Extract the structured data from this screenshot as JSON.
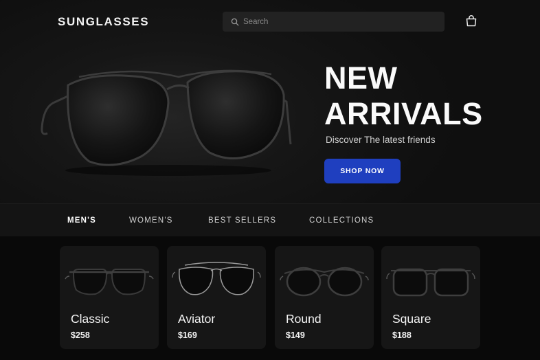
{
  "header": {
    "brand": "SUNGLASSES",
    "search_placeholder": "Search"
  },
  "hero": {
    "title_line1": "NEW",
    "title_line2": "ARRIVALS",
    "subtitle": "Discover The latest friends",
    "cta": "SHOP NOW",
    "cta_color": "#1f3fbf"
  },
  "categories": [
    {
      "label": "MEN'S",
      "active": true
    },
    {
      "label": "WOMEN'S",
      "active": false
    },
    {
      "label": "BEST SELLERS",
      "active": false
    },
    {
      "label": "COLLECTIONS",
      "active": false
    }
  ],
  "products": [
    {
      "name": "Classic",
      "price": "$258",
      "style": "classic"
    },
    {
      "name": "Aviator",
      "price": "$169",
      "style": "aviator"
    },
    {
      "name": "Round",
      "price": "$149",
      "style": "round"
    },
    {
      "name": "Square",
      "price": "$188",
      "style": "square"
    }
  ],
  "icons": [
    "search-icon",
    "shopping-bag-icon"
  ]
}
